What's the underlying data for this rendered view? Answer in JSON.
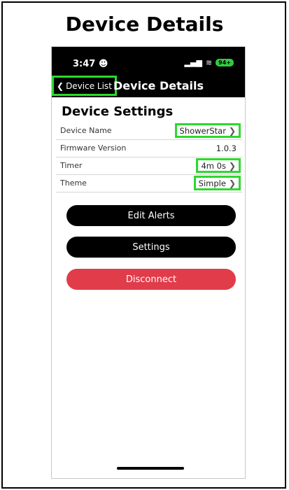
{
  "header": {
    "title": "Device Details"
  },
  "status_bar": {
    "time": "3:47",
    "battery": "94+"
  },
  "nav": {
    "back_label": "Device List",
    "title": "Device Details"
  },
  "settings": {
    "section_title": "Device Settings",
    "rows": [
      {
        "label": "Device Name",
        "value": "ShowerStar"
      },
      {
        "label": "Firmware Version",
        "value": "1.0.3"
      },
      {
        "label": "Timer",
        "value": "4m 0s"
      },
      {
        "label": "Theme",
        "value": "Simple"
      }
    ]
  },
  "buttons": {
    "edit_alerts": "Edit Alerts",
    "settings": "Settings",
    "disconnect": "Disconnect"
  },
  "colors": {
    "highlight": "#2ed82e",
    "disconnect": "#e03c4a",
    "status_battery": "#2ecc40"
  },
  "icons": [
    "chevron-left-icon",
    "chevron-right-icon",
    "signal-icon",
    "wifi-icon",
    "battery-icon",
    "emoji-icon"
  ]
}
